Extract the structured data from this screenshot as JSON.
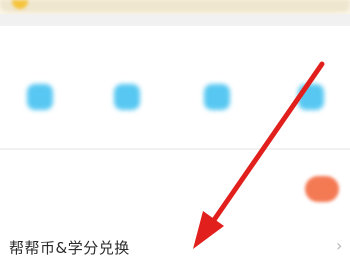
{
  "tools_section": {
    "title": "",
    "items": [
      {
        "icon": "tool-icon",
        "label": ""
      },
      {
        "icon": "tool-icon",
        "label": ""
      },
      {
        "icon": "tool-icon",
        "label": ""
      },
      {
        "icon": "tool-icon",
        "label": ""
      }
    ]
  },
  "task_row": {
    "title": "",
    "subtitle": "",
    "badge_color": "#f47a54"
  },
  "exchange_row": {
    "label": "帮帮币&学分兑换",
    "chevron": "›"
  },
  "annotation": {
    "arrow_color": "#e1201d"
  }
}
